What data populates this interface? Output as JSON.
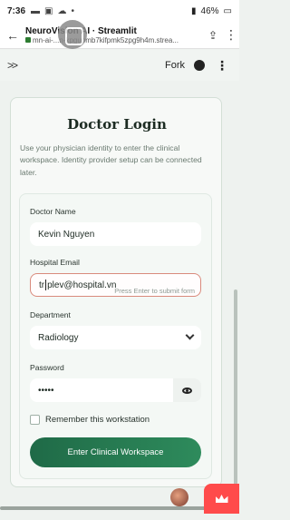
{
  "status_bar": {
    "time": "7:36",
    "battery": "46%"
  },
  "browser": {
    "title": "NeuroVision AI · Streamlit",
    "url": "mn-ai-...n-kpgupmb7kifpmk5zpg9h4m.strea..."
  },
  "app_header": {
    "fork_label": "Fork"
  },
  "card": {
    "title": "Doctor Login",
    "description": "Use your physician identity to enter the clinical workspace. Identity provider setup can be connected later."
  },
  "form": {
    "doctor_name_label": "Doctor Name",
    "doctor_name_value": "Kevin Nguyen",
    "email_label": "Hospital Email",
    "email_value_prefix": "tr",
    "email_value_suffix": "plev@hospital.vn",
    "email_hint": "Press Enter to submit form",
    "department_label": "Department",
    "department_value": "Radiology",
    "password_label": "Password",
    "password_value": "•••••",
    "remember_label": "Remember this workstation",
    "submit_label": "Enter Clinical Workspace"
  },
  "icons": {
    "back": "arrow-left-icon",
    "lock": "lock-icon",
    "share": "share-icon",
    "menu": "kebab-menu-icon",
    "expand": "double-chevron-right-icon",
    "github": "github-icon",
    "chevron": "chevron-down-icon",
    "eye": "eye-icon",
    "crown": "crown-icon"
  },
  "colors": {
    "accent": "#2e8b5c",
    "focus_border": "#d98a7c",
    "streamlit_badge": "#ff4b4b"
  }
}
